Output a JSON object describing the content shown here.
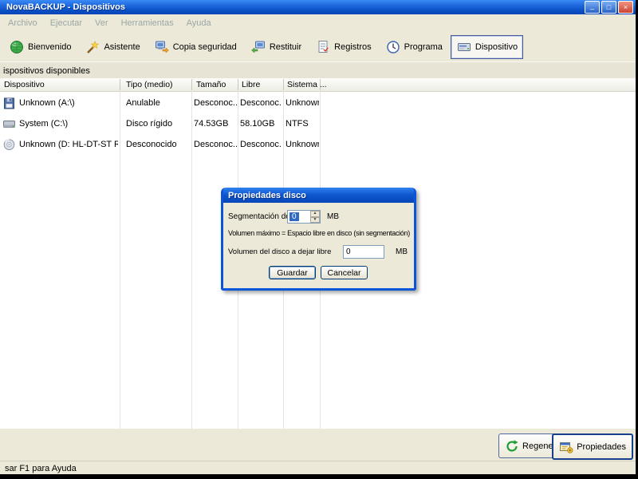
{
  "window": {
    "title": "NovaBACKUP - Dispositivos",
    "controls": {
      "minimize": "_",
      "maximize": "□",
      "close": "×"
    }
  },
  "menu": {
    "items": [
      "Archivo",
      "Ejecutar",
      "Ver",
      "Herramientas",
      "Ayuda"
    ]
  },
  "toolbar": {
    "buttons": [
      {
        "label": "Bienvenido",
        "icon": "welcome-globe-icon"
      },
      {
        "label": "Asistente",
        "icon": "wizard-wand-icon"
      },
      {
        "label": "Copia seguridad",
        "icon": "backup-icon"
      },
      {
        "label": "Restituir",
        "icon": "restore-icon"
      },
      {
        "label": "Registros",
        "icon": "logs-icon"
      },
      {
        "label": "Programa",
        "icon": "schedule-clock-icon"
      },
      {
        "label": "Dispositivo",
        "icon": "device-drive-icon",
        "selected": true
      }
    ]
  },
  "panel": {
    "caption": "ispositivos disponibles"
  },
  "table": {
    "columns": [
      "Dispositivo",
      "Tipo (medio)",
      "Tamaño",
      "Libre",
      "Sistema ..."
    ],
    "rows": [
      {
        "icon": "floppy-disk-icon",
        "device": "Unknown (A:\\)",
        "type": "Anulable",
        "size": "Desconoc...",
        "free": "Desconoc...",
        "system": "Unknown"
      },
      {
        "icon": "hard-disk-icon",
        "device": "System (C:\\)",
        "type": "Disco rígido",
        "size": "74.53GB",
        "free": "58.10GB",
        "system": "NTFS"
      },
      {
        "icon": "cdrom-drive-icon",
        "device": "Unknown (D: HL-DT-ST RW/DV...",
        "type": "Desconocido",
        "size": "Desconoc...",
        "free": "Desconoc...",
        "system": "Unknown"
      }
    ]
  },
  "dialog": {
    "title": "Propiedades disco",
    "segment_label": "Segmentación de",
    "segment_value": "0",
    "segment_unit": "MB",
    "info_text": "Volumen máximo = Espacio libre en disco (sin segmentación)",
    "free_label": "Volumen del disco a dejar libre",
    "free_value": "0",
    "free_unit": "MB",
    "save_label": "Guardar",
    "cancel_label": "Cancelar",
    "spin_up": "▲",
    "spin_down": "▼"
  },
  "bottom": {
    "regenerate_label": "Regenerar",
    "properties_label": "Propiedades"
  },
  "statusbar": {
    "text": "sar F1 para Ayuda"
  },
  "colors": {
    "titlebar_blue": "#0b55d8",
    "selection_blue": "#316AC5",
    "window_bg": "#ECE9D8"
  }
}
